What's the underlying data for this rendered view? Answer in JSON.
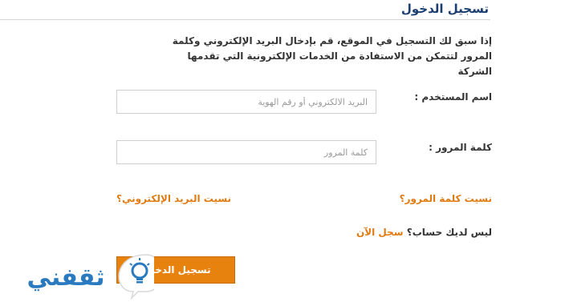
{
  "page": {
    "title": "تسجيل الدخول",
    "description": "إذا سبق لك التسجيل في الموقع، قم بإدخال البريد الإلكتروني وكلمة المرور لتتمكن من الاستفادة من الخدمات الإلكترونية التي تقدمها الشركة"
  },
  "form": {
    "username_label": "اسم المستخدم :",
    "username_placeholder": "البريد الالكتروني أو رقم الهوية",
    "password_label": "كلمة المرور :",
    "password_placeholder": "كلمة المرور",
    "forgot_password": "نسيت كلمة المرور؟",
    "forgot_email": "نسيت البريد الإلكتروني؟",
    "no_account": "ليس لديك حساب؟",
    "register_now": "سجل الآن",
    "login_button": "تسجيل الدخول"
  },
  "logo": {
    "text": "ثقفني",
    "icon": "lightbulb-icon",
    "colors": {
      "text": "#2a7ac0",
      "bubble": "#ffffff",
      "bulb": "#2a7ac0"
    }
  },
  "colors": {
    "title": "#1b3e70",
    "accent": "#e8820f",
    "link": "#e07b12"
  }
}
